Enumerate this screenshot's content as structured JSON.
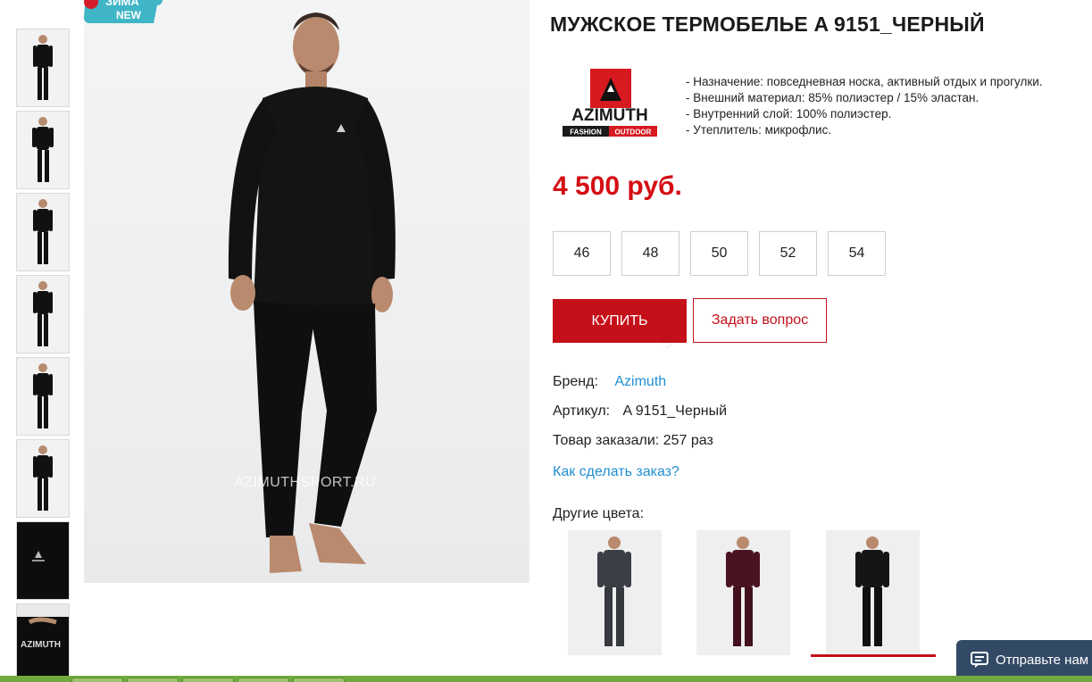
{
  "badge": {
    "top": "ЗИМА",
    "bottom": "NEW"
  },
  "photo_watermark": "AZIMUTHSPORT.RU",
  "product": {
    "title": "МУЖСКОЕ ТЕРМОБЕЛЬЕ A 9151_ЧЕРНЫЙ",
    "brand_logo": {
      "name": "AZIMUTH",
      "tag_left": "FASHION",
      "tag_right": "OUTDOOR"
    },
    "features": [
      "- Назначение: повседневная носка, активный отдых и прогулки.",
      "- Внешний материал: 85% полиэстер / 15% эластан.",
      "- Внутренний слой: 100% полиэстер.",
      "- Утеплитель: микрофлис."
    ],
    "price": "4 500 руб.",
    "sizes": [
      "46",
      "48",
      "50",
      "52",
      "54"
    ],
    "buy_label": "КУПИТЬ",
    "ask_label": "Задать вопрос",
    "brand_label": "Бренд:",
    "brand_value": "Azimuth",
    "article_label": "Артикул:",
    "article_value": "A 9151_Черный",
    "ordered_text": "Товар заказали: 257 раз",
    "howto_link": "Как сделать заказ?",
    "other_colors_label": "Другие цвета:"
  },
  "chat": {
    "label": "Отправьте нам"
  },
  "colors": {
    "accent": "#c5101a",
    "link": "#1f8fd0",
    "price": "#d40e14",
    "chat_bg": "#334a66"
  }
}
